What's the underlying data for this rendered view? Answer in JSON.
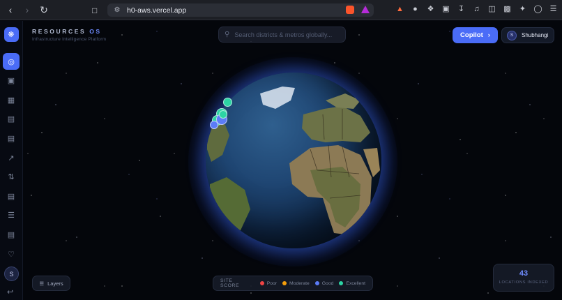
{
  "browser": {
    "url": "h0-aws.vercel.app",
    "icons": [
      "back-icon",
      "forward-icon",
      "reload-icon",
      "bookmark-icon",
      "site-settings-icon",
      "key-icon",
      "share-icon",
      "brave-shield-icon",
      "brave-rewards-icon",
      "extension-fox-icon",
      "extension-circle-icon",
      "puzzle-icon",
      "extension-box-icon",
      "download-icon",
      "media-icon",
      "sidebar-icon",
      "wallet-icon",
      "sparkle-icon",
      "vpn-icon",
      "menu-icon"
    ]
  },
  "app": {
    "brand": {
      "title": "RESOURCES",
      "title_accent": "OS",
      "subtitle": "Infrastructure Intelligence Platform"
    },
    "search": {
      "placeholder": "Search districts & metros globally..."
    },
    "copilot": {
      "label": "Copilot"
    },
    "user": {
      "initial": "S",
      "name": "Shubhangi"
    },
    "sidebar": {
      "items": [
        {
          "name": "globe"
        },
        {
          "name": "robot"
        },
        {
          "name": "grid"
        },
        {
          "name": "building"
        },
        {
          "name": "document"
        },
        {
          "name": "trend"
        },
        {
          "name": "route"
        },
        {
          "name": "clipboard"
        },
        {
          "name": "sliders"
        },
        {
          "name": "newspaper"
        },
        {
          "name": "bell"
        }
      ],
      "avatar_initial": "S"
    },
    "layers": {
      "label": "Layers"
    },
    "legend": {
      "title": "SITE SCORE",
      "items": [
        {
          "label": "Poor",
          "color": "#ef4444"
        },
        {
          "label": "Moderate",
          "color": "#f59e0b"
        },
        {
          "label": "Good",
          "color": "#5b7cf7"
        },
        {
          "label": "Excellent",
          "color": "#2dd4a4"
        }
      ]
    },
    "stats": {
      "count": "43",
      "label": "LOCATIONS INDEXED"
    }
  }
}
